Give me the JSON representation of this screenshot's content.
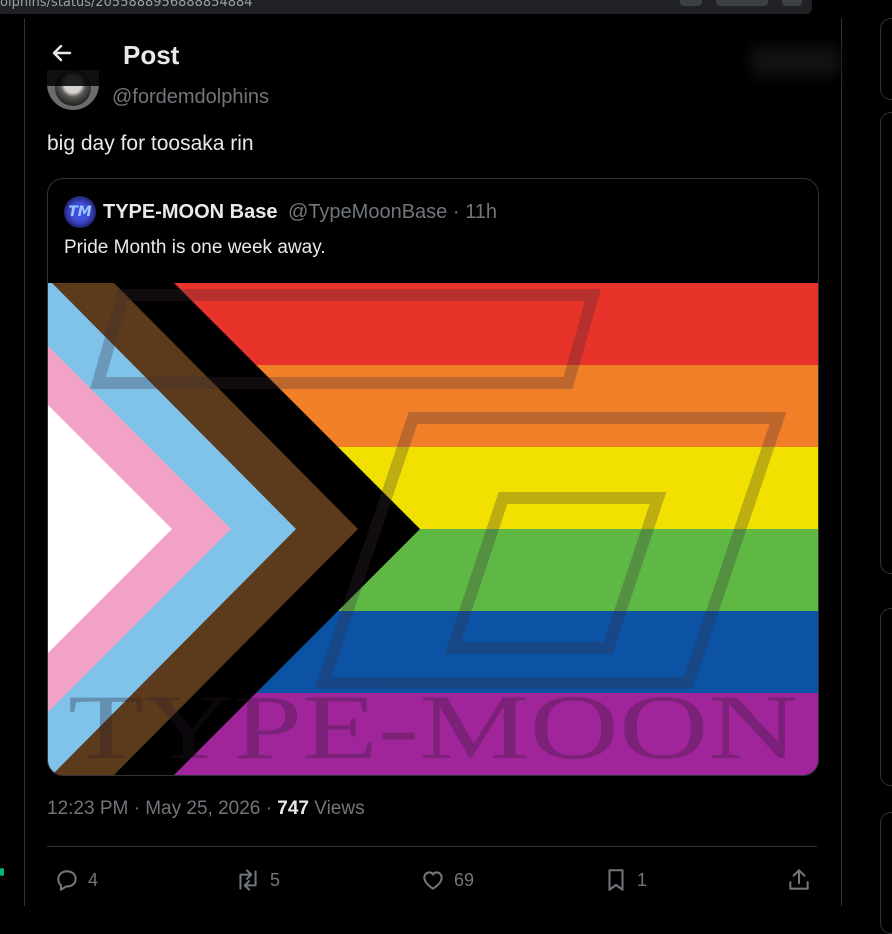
{
  "browser": {
    "url": "olphins/status/2055888956888854884"
  },
  "header": {
    "title": "Post"
  },
  "author": {
    "handle": "@fordemdolphins"
  },
  "post": {
    "text": "big day for toosaka rin",
    "time": "12:23 PM",
    "date": "May 25, 2026",
    "views_count": "747",
    "views_label": "Views"
  },
  "quote": {
    "name": "TYPE-MOON Base",
    "handle": "@TypeMoonBase",
    "age": "11h",
    "text": "Pride Month is one week away.",
    "logo_letters": "TM",
    "watermark": "TYPE-MOON"
  },
  "actions": {
    "replies": "4",
    "reposts": "5",
    "likes": "69",
    "bookmarks": "1"
  },
  "icons": [
    "back-arrow-icon",
    "reply-icon",
    "repost-icon",
    "like-icon",
    "bookmark-icon",
    "share-icon"
  ],
  "colors": {
    "background": "#000000",
    "text": "#e7e9ea",
    "muted": "#71767b",
    "border": "#2f3336",
    "flag_red": "#e7332a",
    "flag_orange": "#f07f28",
    "flag_yellow": "#f1e000",
    "flag_green": "#5fb844",
    "flag_blue": "#0c52a5",
    "flag_purple": "#a0259b",
    "flag_lightblue": "#7fc3ea",
    "flag_pink": "#f2a2c4",
    "flag_brown": "#5c3b1d"
  }
}
